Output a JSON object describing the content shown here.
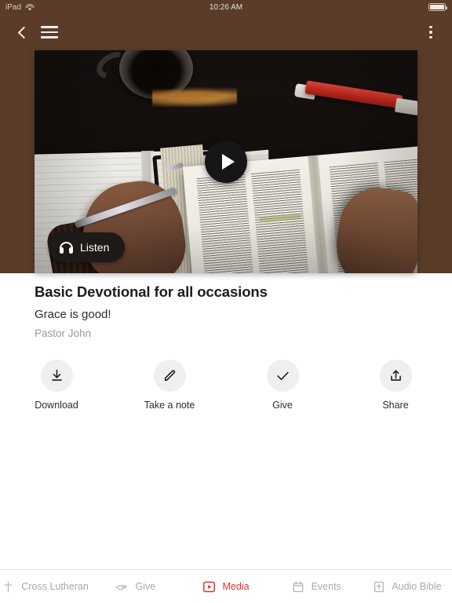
{
  "status_bar": {
    "device": "iPad",
    "wifi_icon": "wifi-icon",
    "time": "10:26 AM",
    "battery_icon": "battery-full-icon"
  },
  "nav_bar": {
    "back_icon": "chevron-left-icon",
    "menu_icon": "hamburger-menu-icon",
    "overflow_icon": "more-vertical-icon",
    "background_color": "#5a3c28"
  },
  "media_card": {
    "play_icon": "play-icon",
    "listen_button": {
      "label": "Listen",
      "icon": "headphones-icon"
    },
    "image_description": "Hand writing in a notebook beside an open Bible, coffee cup and red highlighter on a dark desk"
  },
  "detail": {
    "title": "Basic Devotional for all occasions",
    "subtitle": "Grace is good!",
    "author": "Pastor John"
  },
  "actions": [
    {
      "label": "Download",
      "icon": "download-icon"
    },
    {
      "label": "Take a note",
      "icon": "pencil-icon"
    },
    {
      "label": "Give",
      "icon": "check-icon"
    },
    {
      "label": "Share",
      "icon": "share-upload-icon"
    }
  ],
  "tab_bar": {
    "active_color": "#e8302a",
    "inactive_color": "#a9a9a9",
    "tabs": [
      {
        "label": "Cross Lutheran",
        "icon": "cross-icon",
        "active": false
      },
      {
        "label": "Give",
        "icon": "giving-hand-icon",
        "active": false
      },
      {
        "label": "Media",
        "icon": "media-play-box-icon",
        "active": true
      },
      {
        "label": "Events",
        "icon": "calendar-icon",
        "active": false
      },
      {
        "label": "Audio Bible",
        "icon": "bible-book-icon",
        "active": false
      }
    ]
  }
}
